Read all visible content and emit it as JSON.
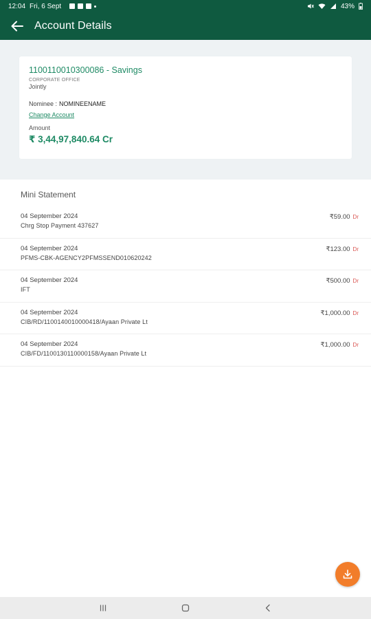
{
  "status_bar": {
    "time": "12:04",
    "date": "Fri, 6 Sept",
    "battery": "43%"
  },
  "header": {
    "title": "Account Details"
  },
  "account": {
    "title": "1100110010300086 - Savings",
    "branch": "CORPORATE OFFICE",
    "mode": "Jointly",
    "nominee_label": "Nominee :",
    "nominee_value": "NOMINEENAME",
    "change_link": "Change Account",
    "amount_label": "Amount",
    "amount_value": "₹ 3,44,97,840.64 Cr"
  },
  "mini_statement": {
    "title": "Mini Statement",
    "rows": [
      {
        "date": "04 September 2024",
        "desc": "Chrg Stop Payment 437627",
        "amount": "₹59.00",
        "type": "Dr"
      },
      {
        "date": "04 September 2024",
        "desc": "PFMS-CBK-AGENCY2PFMSSEND010620242",
        "amount": "₹123.00",
        "type": "Dr"
      },
      {
        "date": "04 September 2024",
        "desc": "IFT",
        "amount": "₹500.00",
        "type": "Dr"
      },
      {
        "date": "04 September 2024",
        "desc": "CIB/RD/1100140010000418/Ayaan Private Lt",
        "amount": "₹1,000.00",
        "type": "Dr"
      },
      {
        "date": "04 September 2024",
        "desc": "CIB/FD/1100130110000158/Ayaan Private Lt",
        "amount": "₹1,000.00",
        "type": "Dr"
      }
    ]
  },
  "colors": {
    "primary": "#0f5a40",
    "accent_text": "#1e8a64",
    "debit": "#d9534f",
    "fab": "#f27d2a"
  },
  "icons": {
    "back": "arrow-back-icon",
    "download": "download-icon",
    "nav_recents": "recents-icon",
    "nav_home": "home-icon",
    "nav_back": "back-icon"
  }
}
